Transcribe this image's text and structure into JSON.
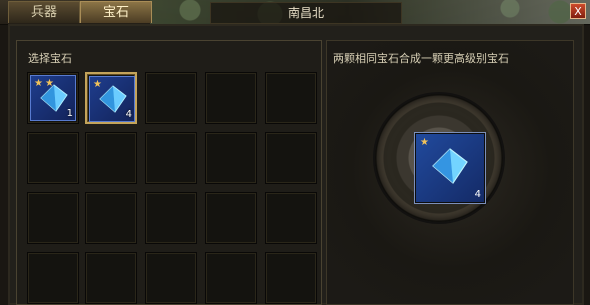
{
  "tabs": [
    {
      "label": "兵器",
      "active": false
    },
    {
      "label": "宝石",
      "active": true
    }
  ],
  "location": "南昌北",
  "close_label": "X",
  "left_panel": {
    "title": "选择宝石",
    "items": [
      {
        "stars": 2,
        "count": "1",
        "selected": false
      },
      {
        "stars": 1,
        "count": "4",
        "selected": true
      }
    ]
  },
  "right_panel": {
    "title": "两颗相同宝石合成一颗更高级别宝石",
    "result": {
      "stars": 1,
      "count": "4"
    }
  },
  "colors": {
    "gold": "#c4a45b",
    "gem_blue": "#5cb7ff"
  },
  "icons": {
    "star": "star-icon",
    "gem": "gem-icon"
  }
}
